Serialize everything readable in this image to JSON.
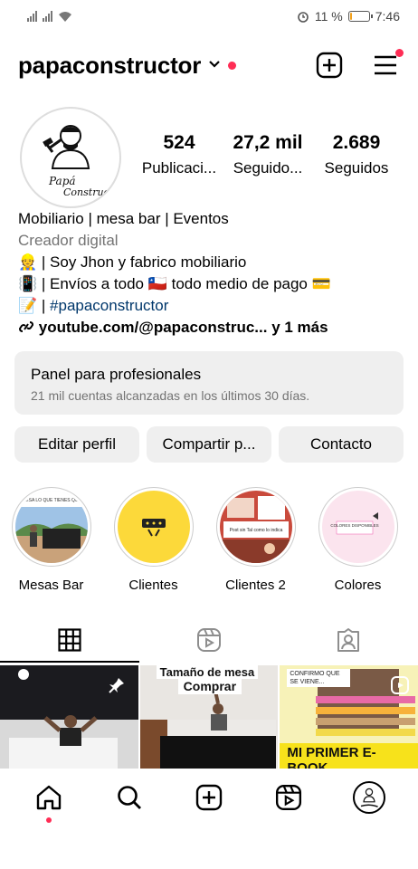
{
  "status": {
    "battery_pct": "11 %",
    "time": "7:46",
    "battery_level": 0.11
  },
  "header": {
    "username": "papaconstructor"
  },
  "stats": [
    {
      "num": "524",
      "label": "Publicaci..."
    },
    {
      "num": "27,2 mil",
      "label": "Seguido..."
    },
    {
      "num": "2.689",
      "label": "Seguidos"
    }
  ],
  "bio": {
    "name": "Mobiliario | mesa bar | Eventos",
    "category": "Creador digital",
    "line1": "👷 | Soy Jhon y fabrico mobiliario",
    "line2": "📳 | Envíos a todo 🇨🇱 todo medio de pago 💳",
    "line3_prefix": "📝 | ",
    "hashtag": "#papaconstructor",
    "link": "youtube.com/@papaconstruc...",
    "link_more": " y 1 más"
  },
  "panel": {
    "title": "Panel para profesionales",
    "subtitle": "21 mil cuentas alcanzadas en los últimos 30 días."
  },
  "buttons": {
    "edit": "Editar perfil",
    "share": "Compartir p...",
    "contact": "Contacto"
  },
  "highlights": [
    {
      "label": "Mesas Bar",
      "thumb_text": "MESA LO QUE TIENES QUE"
    },
    {
      "label": "Clientes"
    },
    {
      "label": "Clientes 2",
      "thumb_text": "Post sin Tal como lo indica"
    },
    {
      "label": "Colores",
      "thumb_text": "COLORES DISPONIBLES"
    }
  ],
  "grid": [
    {
      "text": ""
    },
    {
      "text1": "Tamaño de mesa",
      "text2": "Comprar"
    },
    {
      "text1": "CONFIRMO QUE SE VIENE...",
      "text2": "MI PRIMER E-BOOK"
    }
  ],
  "avatar_text": {
    "line1": "Papá",
    "line2": "Constructor"
  },
  "colors": {
    "accent": "#ff2d55",
    "button_bg": "#efefef",
    "link": "#00376b"
  }
}
